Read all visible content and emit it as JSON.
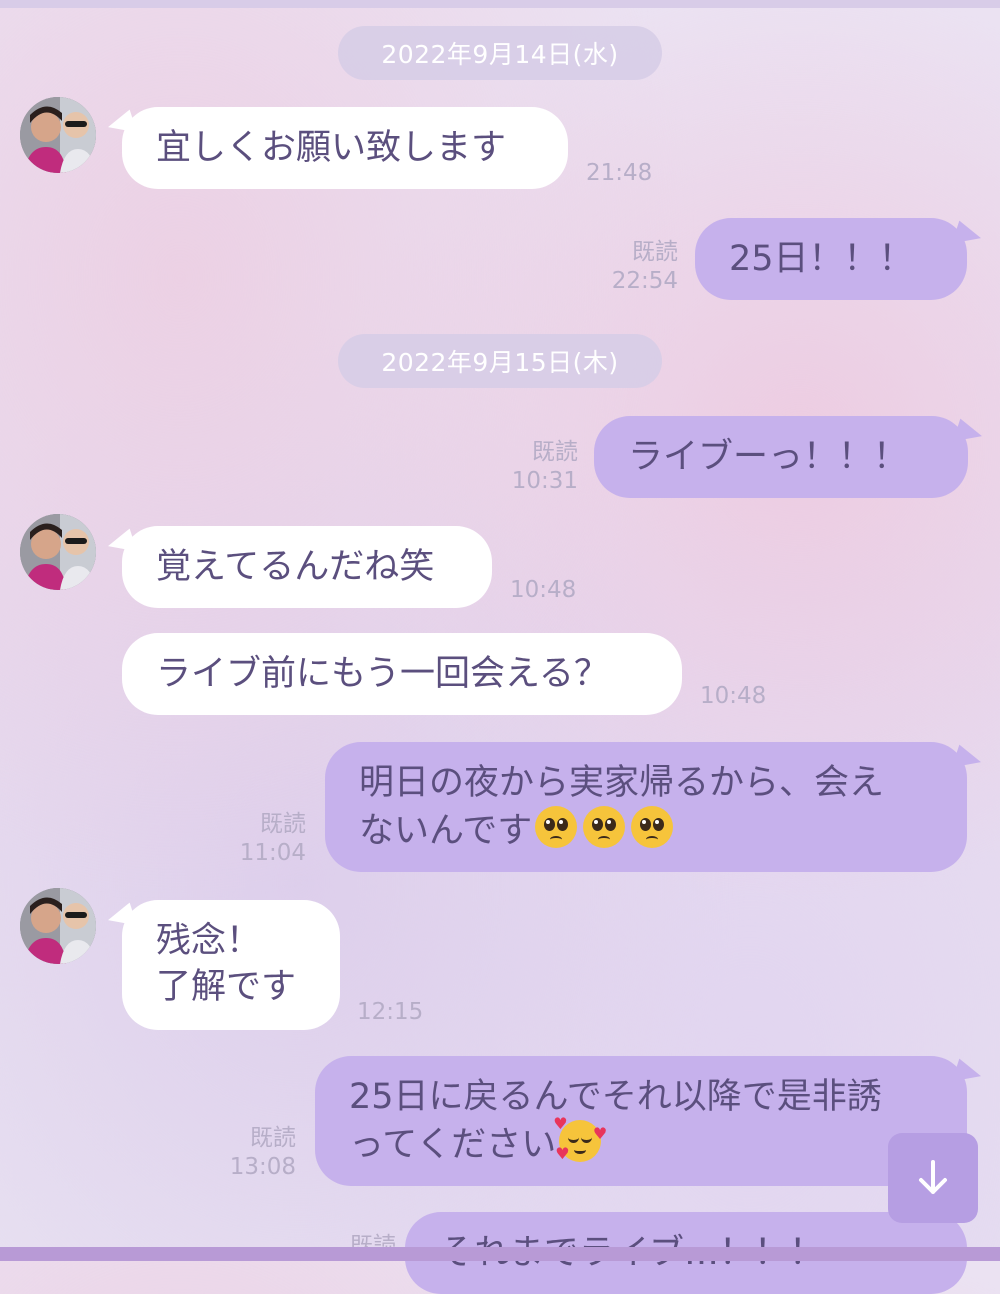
{
  "dates": [
    "2022年9月14日(水)",
    "2022年9月15日(木)"
  ],
  "messages": [
    {
      "text": "宜しくお願い致します",
      "time": "21:48"
    },
    {
      "text": "25日！！！",
      "read": "既読",
      "time": "22:54"
    },
    {
      "text": "ライブーっ！！！",
      "read": "既読",
      "time": "10:31"
    },
    {
      "text": "覚えてるんだね笑",
      "time": "10:48"
    },
    {
      "text": "ライブ前にもう一回会える？",
      "time": "10:48"
    },
    {
      "line1": "明日の夜から実家帰るから、会え",
      "line2": "ないんです",
      "read": "既読",
      "time": "11:04",
      "emoji": "pleading-face"
    },
    {
      "line1": "残念！",
      "line2": "了解です",
      "time": "12:15"
    },
    {
      "line1": "25日に戻るんでそれ以降で是非誘",
      "line2": "ってください",
      "read": "既読",
      "time": "13:08",
      "emoji": "smiling-face-with-hearts"
    },
    {
      "text": "それまでライブ…！！！",
      "read": "既読"
    }
  ],
  "colors": {
    "outgoing_bubble": "#c6b1ec",
    "incoming_bubble": "#ffffff",
    "message_text": "#5b4f7e",
    "meta_text": "#b7aec8",
    "scroll_button": "#b69ee3"
  },
  "scroll_button_icon": "arrow-down-icon"
}
